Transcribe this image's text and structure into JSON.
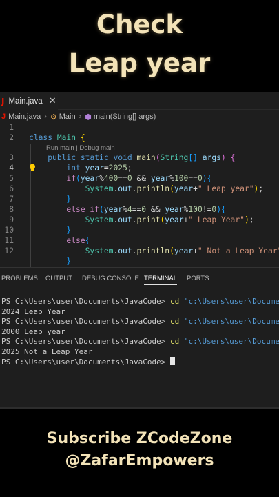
{
  "overlay": {
    "headline_line1": "Check",
    "headline_line2": "Leap year",
    "footer_line1": "Subscribe ZCodeZone",
    "footer_line2": "@ZafarEmpowers"
  },
  "tab": {
    "icon": "J",
    "label": "Main.java",
    "close": "✕"
  },
  "breadcrumb": {
    "file": "Main.java",
    "class": "Main",
    "method": "main(String[] args)"
  },
  "codelens": "Run main | Debug main",
  "line_numbers": [
    "1",
    "2",
    "3",
    "4",
    "5",
    "6",
    "7",
    "8",
    "9",
    "10",
    "11",
    "12"
  ],
  "panel_tabs": [
    "PROBLEMS",
    "OUTPUT",
    "DEBUG CONSOLE",
    "TERMINAL",
    "PORTS"
  ],
  "active_panel_tab": "TERMINAL",
  "terminal": {
    "prompt": "PS C:\\Users\\user\\Documents\\JavaCode> ",
    "cmd": "cd",
    "arg": "\"c:\\Users\\user\\Documents\\J",
    "out1": "2024 Leap Year",
    "out2": "2000 Leap year",
    "out3": "2025 Not a Leap Year"
  },
  "colors": {
    "editor_bg": "#1e1e1e",
    "keyword": "#569cd6",
    "control": "#c586c0",
    "type": "#4ec9b0",
    "function": "#dcdcaa",
    "string": "#ce9178",
    "headline": "#f3e3b8"
  },
  "icons": {
    "tab_icon": "java-icon",
    "close": "close-icon",
    "class": "class-icon",
    "method": "method-cube-icon",
    "lightbulb": "lightbulb-icon"
  }
}
